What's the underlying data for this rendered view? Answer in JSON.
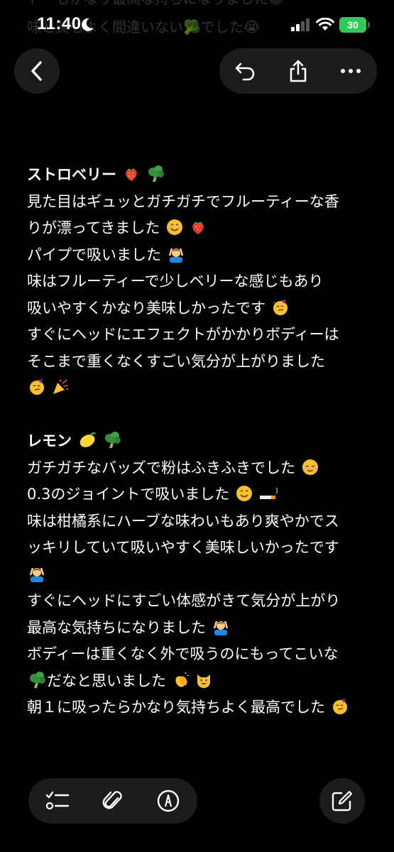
{
  "faded_text": {
    "line1": "味と質もよく間違いない🥦でした😭",
    "line0": "トーもかなり最高な持ちになりました😁"
  },
  "status_bar": {
    "time": "11:40",
    "battery": "30"
  },
  "toolbar": {
    "back_icon": "chevron-left-icon",
    "undo_icon": "undo-icon",
    "share_icon": "share-icon",
    "more_icon": "more-icon"
  },
  "note": {
    "sections": [
      {
        "heading": "ストロベリー",
        "heading_emojis": [
          "strawberry",
          "broccoli"
        ],
        "lines": [
          "見た目はギュッとガチガチでフルーティーな香",
          "りが漂ってきました",
          "パイプで吸いました",
          "味はフルーティーで少しベリーな感じもあり",
          "吸いやすくかなり美味しかったです",
          "すぐにヘッドにエフェクトがかかりボディーは",
          "そこまで重くなくすごい気分が上がりました",
          ""
        ]
      },
      {
        "heading": "レモン",
        "heading_emojis": [
          "lemon",
          "broccoli"
        ],
        "lines": [
          "ガチガチなバッズで粉はふきふきでした",
          "0.3のジョイントで吸いました",
          "味は柑橘系にハーブな味わいもあり爽やかでス",
          "ッキリしていて吸いやすく美味しいかったです",
          "",
          "すぐにヘッドにすごい体感がきて気分が上がり",
          "最高な気持ちになりました",
          "ボディーは重くなく外で吸うのにもってこいな",
          "だなと思いました",
          "朝１に吸ったらかなり気持ちよく最高でした"
        ]
      }
    ]
  },
  "bottom_bar": {
    "checklist_icon": "checklist-icon",
    "attachment_icon": "paperclip-icon",
    "markup_icon": "markup-pen-icon",
    "compose_icon": "compose-icon"
  },
  "colors": {
    "background": "#000000",
    "button_bg": "#1c1c1e",
    "battery": "#34c759"
  }
}
